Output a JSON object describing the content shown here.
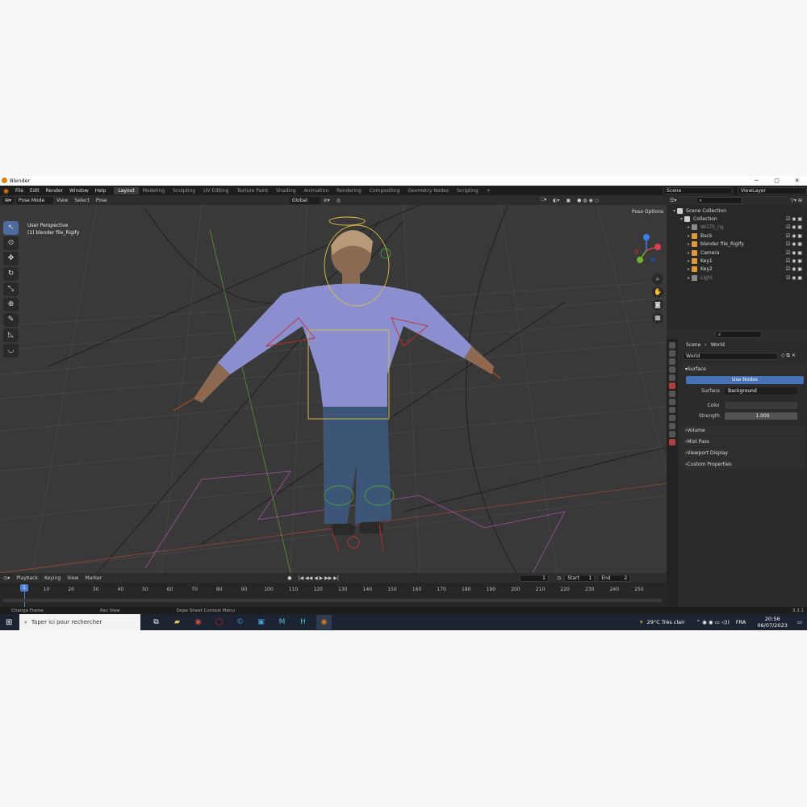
{
  "window": {
    "title": "Blender",
    "minimize": "─",
    "maximize": "▢",
    "close": "✕"
  },
  "menu": [
    "File",
    "Edit",
    "Render",
    "Window",
    "Help"
  ],
  "workspaces": [
    "Layout",
    "Modeling",
    "Sculpting",
    "UV Editing",
    "Texture Paint",
    "Shading",
    "Animation",
    "Rendering",
    "Compositing",
    "Geometry Nodes",
    "Scripting",
    "+"
  ],
  "scene_name": "Scene",
  "viewlayer_name": "ViewLayer",
  "viewport": {
    "mode": "Pose Mode",
    "menus": [
      "View",
      "Select",
      "Pose"
    ],
    "orientation": "Global",
    "perspective": "User Perspective",
    "object": "(1) blender file_Rigify",
    "pose_options": "Pose Options"
  },
  "outliner": {
    "rows": [
      {
        "label": "Scene Collection",
        "color": "#cccccc",
        "indent": 0
      },
      {
        "label": "Collection",
        "color": "#cccccc",
        "indent": 1
      },
      {
        "label": "WGTS_rig",
        "color": "#8a8a8a",
        "indent": 2
      },
      {
        "label": "Back",
        "color": "#e09a3c",
        "indent": 2
      },
      {
        "label": "blender file_Rigify",
        "color": "#e09a3c",
        "indent": 2
      },
      {
        "label": "Camera",
        "color": "#e09a3c",
        "indent": 2
      },
      {
        "label": "Key1",
        "color": "#e09a3c",
        "indent": 2
      },
      {
        "label": "Key2",
        "color": "#e09a3c",
        "indent": 2
      },
      {
        "label": "Light",
        "color": "#8a8a8a",
        "indent": 2
      }
    ]
  },
  "properties": {
    "breadcrumb_scene": "Scene",
    "breadcrumb_world": "World",
    "world_name": "World",
    "surface_header": "Surface",
    "use_nodes": "Use Nodes",
    "surface_label": "Surface",
    "surface_value": "Background",
    "color_label": "Color",
    "strength_label": "Strength",
    "strength_value": "1.000",
    "sections": [
      "Volume",
      "Mist Pass",
      "Viewport Display",
      "Custom Properties"
    ]
  },
  "timeline": {
    "menus": [
      "Playback",
      "Keying",
      "View",
      "Marker"
    ],
    "current_frame": "1",
    "start_label": "Start",
    "start_value": "1",
    "end_label": "End",
    "end_value": "2",
    "ticks": [
      "1",
      "10",
      "20",
      "30",
      "40",
      "50",
      "60",
      "70",
      "80",
      "90",
      "100",
      "110",
      "120",
      "130",
      "140",
      "150",
      "160",
      "170",
      "180",
      "190",
      "200",
      "210",
      "220",
      "230",
      "240",
      "250"
    ]
  },
  "statusbar": {
    "left": "Change Frame",
    "middle": "Pan View",
    "right": "Dope Sheet Context Menu",
    "version": "3.3.1"
  },
  "taskbar": {
    "search_placeholder": "Taper ici pour rechercher",
    "weather": "29°C  Très clair",
    "lang": "FRA",
    "time": "20:56",
    "date": "06/07/2023"
  }
}
